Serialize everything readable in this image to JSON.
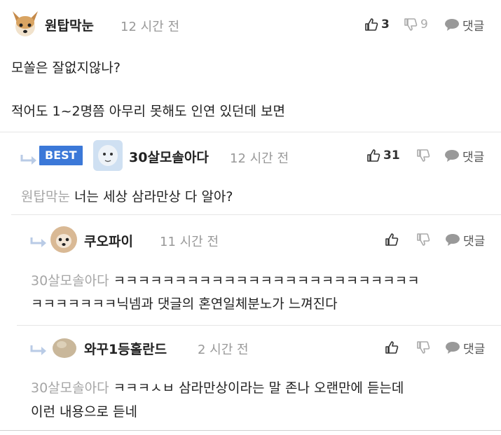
{
  "comments": [
    {
      "nickname": "원탑막눈",
      "time": "12 시간 전",
      "likes": "3",
      "dislikes": "9",
      "reply_label": "댓글",
      "lines": [
        "모쏠은 잘없지않나?",
        "적어도 1~2명쯤 아무리 못해도 인연 있던데 보면"
      ]
    },
    {
      "badge": "BEST",
      "nickname": "30살모솔아다",
      "time": "12 시간 전",
      "likes": "31",
      "reply_label": "댓글",
      "mention": "원탑막눈",
      "lines": [
        "너는 세상 삼라만상 다 알아?"
      ]
    },
    {
      "nickname": "쿠오파이",
      "time": "11 시간 전",
      "reply_label": "댓글",
      "mention": "30살모솔아다",
      "lines": [
        "ㅋㅋㅋㅋㅋㅋㅋㅋㅋㅋㅋㅋㅋㅋㅋㅋㅋㅋㅋㅋㅋㅋㅋㅋㅋ",
        "ㅋㅋㅋㅋㅋㅋㅋ닉넴과 댓글의 혼연일체분노가 느껴진다"
      ]
    },
    {
      "nickname": "와꾸1등홀란드",
      "time": "2 시간 전",
      "reply_label": "댓글",
      "mention": "30살모솔아다",
      "lines": [
        "ㅋㅋㅋㅅㅂ 삼라만상이라는 말 존나 오랜만에 듣는데",
        "이런 내용으로 듣네"
      ]
    }
  ],
  "colors": {
    "best_badge": "#3b78d8",
    "mention": "#a6a6a6",
    "time": "#999999",
    "divider": "#e6e6e6"
  },
  "icons": [
    "thumbs-up-icon",
    "thumbs-down-icon",
    "speech-bubble-icon",
    "reply-arrow-icon"
  ]
}
